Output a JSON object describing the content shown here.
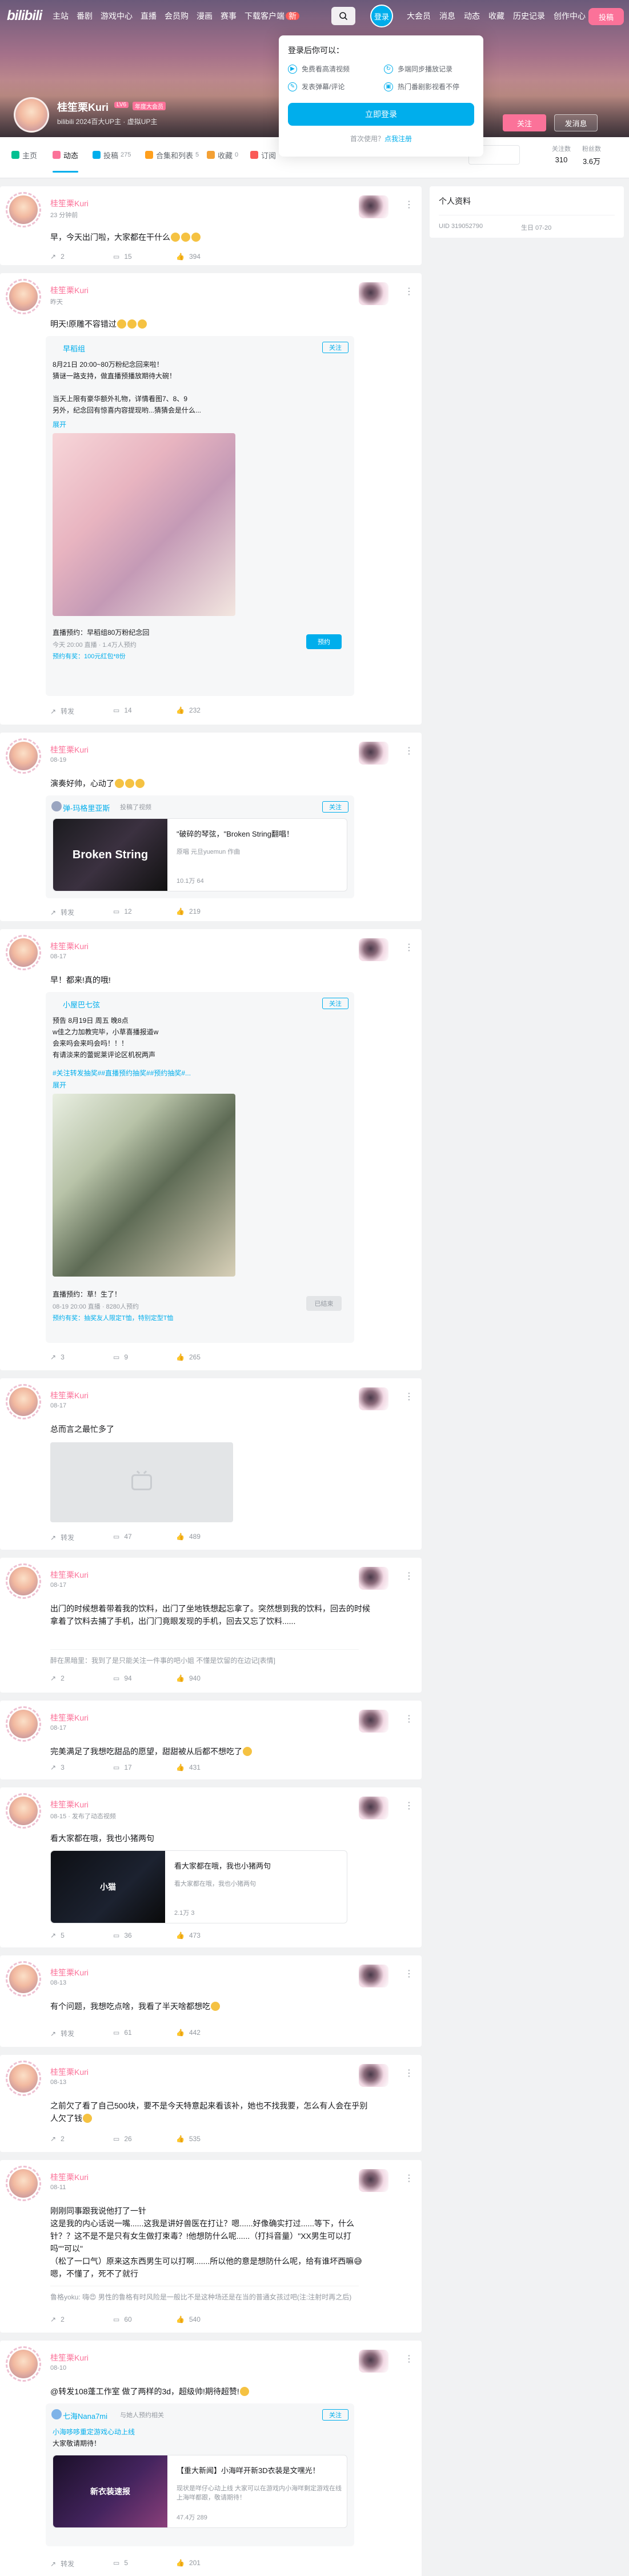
{
  "header": {
    "logo": "bilibili",
    "nav": [
      "主站",
      "番剧",
      "游戏中心",
      "直播",
      "会员购",
      "漫画",
      "赛事",
      "下载客户端"
    ],
    "new_badge": "新",
    "login": "登录",
    "nav_right": [
      "大会员",
      "消息",
      "动态",
      "收藏",
      "历史记录",
      "创作中心"
    ],
    "upload": "投稿"
  },
  "login_popup": {
    "title": "登录后你可以：",
    "perks": [
      "免费看高清视频",
      "多端同步播放记录",
      "发表弹幕/评论",
      "热门番剧影视看不停"
    ],
    "button": "立即登录",
    "foot_text": "首次使用？",
    "foot_link": "点我注册"
  },
  "profile": {
    "name": "桂笙栗Kuri",
    "level": "LV6",
    "vip": "年度大会员",
    "sign": "bilibili 2024百大UP主 · 虚拟UP主",
    "follow": "关注",
    "message": "发消息"
  },
  "tabs": [
    {
      "label": "主页",
      "count": ""
    },
    {
      "label": "动态",
      "count": ""
    },
    {
      "label": "投稿",
      "count": "275"
    },
    {
      "label": "合集和列表",
      "count": "5"
    },
    {
      "label": "收藏",
      "count": "0"
    },
    {
      "label": "订阅",
      "count": ""
    }
  ],
  "stats": [
    {
      "label": "关注数",
      "value": "310"
    },
    {
      "label": "粉丝数",
      "value": "3.6万"
    }
  ],
  "sidebar": {
    "title": "个人资料",
    "uid": "UID 319052790",
    "birthday": "生日 07-20"
  },
  "posts": [
    {
      "name": "桂笙栗Kuri",
      "date": "23 分钟前",
      "text": "早，今天出门啦，大家都在干什么",
      "actions": [
        "2",
        "15",
        "394"
      ]
    },
    {
      "name": "桂笙栗Kuri",
      "date": "昨天",
      "text": "明天!原雕不容错过",
      "repost_name": "早稻组",
      "repost_follow": "关注",
      "repost_lines": [
        "8月21日 20:00~80万粉纪念回来啦！",
        "猜谜一路支持，做直播预播放期待大碗！",
        "",
        "当天上限有豪华额外礼物，详情看图7、8、9",
        "另外，纪念回有惊喜内容提现哟...猜猜会是什么..."
      ],
      "expand": "展开",
      "live_title": "直播预约：早稻组80万粉纪念回",
      "live_date": "今天 20:00 直播 · 1.4万人预约",
      "live_link": "预约有奖：100元红包*8份",
      "live_btn": "预约",
      "actions": [
        "转发",
        "14",
        "232"
      ]
    },
    {
      "name": "桂笙栗Kuri",
      "date": "08-19",
      "text": "演奏好帅，心动了",
      "repost_name": "弹-玛格里亚斯",
      "repost_sub": "投稿了视频",
      "repost_follow": "关注",
      "video_title": "\"破碎的琴弦，\"Broken String翻唱！",
      "video_desc": "原唱 元旦yuemun 作曲",
      "video_stats": "10.1万   64",
      "thumb_text": "Broken String",
      "actions": [
        "转发",
        "12",
        "219"
      ]
    },
    {
      "name": "桂笙栗Kuri",
      "date": "08-17",
      "text": "早！都来!真的哦!",
      "repost_name": "小屋巴七弦",
      "repost_follow": "关注",
      "repost_lines": [
        "预告  8月19日 周五 晚8点",
        "w佳之力加教完毕，小草喜播报道w",
        "会来吗会来吗会吗！！！",
        "有请淡来的蕾妮莱评论区机祝两声"
      ],
      "repost_tags": "#关注转发抽奖##直播预约抽奖##预约抽奖#...",
      "expand": "展开",
      "live_title": "直播预约：草！生了！",
      "live_date": "08-19 20:00 直播 · 8280人预约",
      "live_link": "预约有奖：抽奖友人限定T恤，特别定型T恤",
      "live_btn": "已结束",
      "actions": [
        "3",
        "9",
        "265"
      ]
    },
    {
      "name": "桂笙栗Kuri",
      "date": "08-17",
      "text": "总而言之最忙多了",
      "actions": [
        "转发",
        "47",
        "489"
      ]
    },
    {
      "name": "桂笙栗Kuri",
      "date": "08-17",
      "text": "出门的时候想着带着我的饮料，出门了坐地铁想起忘拿了。突然想到我的饮料，回去的时候拿着了饮料去捕了手机，出门门竟眼发现的手机，回去又忘了饮料......",
      "comment": "醉在黑暗里：我到了是只能关注一件事的吧小姐 不懂是饮留的在边记[表情]",
      "actions": [
        "2",
        "94",
        "940"
      ]
    },
    {
      "name": "桂笙栗Kuri",
      "date": "08-17",
      "text": "完美满足了我想吃甜品的愿望，甜甜被从后都不想吃了",
      "actions": [
        "3",
        "17",
        "431"
      ]
    },
    {
      "name": "桂笙栗Kuri",
      "date": "08-15 · 发布了动态视频",
      "text": "看大家都在哦，我也小猪两句",
      "video_title": "看大家都在哦，我也小猪两句",
      "video_desc": "看大家都在哦，我也小猪两句",
      "video_stats": "2.1万   3",
      "thumb_text": "小猫",
      "actions": [
        "5",
        "36",
        "473"
      ]
    },
    {
      "name": "桂笙栗Kuri",
      "date": "08-13",
      "text": "有个问题，我想吃点啥，我看了半天啥都想吃",
      "actions": [
        "转发",
        "61",
        "442"
      ]
    },
    {
      "name": "桂笙栗Kuri",
      "date": "08-13",
      "text": "之前欠了看了自己500块，要不是今天特意起来看该补，她也不找我要，怎么有人会在乎别人欠了钱",
      "actions": [
        "2",
        "26",
        "535"
      ]
    },
    {
      "name": "桂笙栗Kuri",
      "date": "08-11",
      "text": "刚刚同事跟我说他打了一针\n这是我的内心话说一嘴......这我是讲好兽医在打让？嗯......好像确实打过......等下，什么针？？这不是不是只有女生做打束毒？!他想防什么呢......（打抖音量）\"XX男生可以打吗\"\"可以\"\n（松了一口气）原来这东西男生可以打啊.......所以他的意是想防什么呢，给有谁坏西嘛😅嗯，不懂了，死不了就行",
      "comment": "鲁格yoku: 嗨😍 男性的鲁格有时风险是一般比不是这种场还是在当的普通女孩过吧(注:注射时再之后)",
      "actions": [
        "2",
        "60",
        "540"
      ]
    },
    {
      "name": "桂笙栗Kuri",
      "date": "08-10",
      "text": "@转发108蓬工作室  做了两样的3d，超级帅!期待超赞!",
      "repost_name": "七海Nana7mi",
      "repost_sub": "与她人预约相关",
      "repost_follow": "关注",
      "repost_lines": [
        "小海哆哆重定游戏心动上线",
        "大家敬请期待！"
      ],
      "video_title": "【重大新闻】小海咩开新3D衣装是文嘿光！",
      "video_desc": "现状是咩仔心动上线 大家可以在游戏内小海咩剩定游戏在线上海咩都跟，敬请期待！",
      "video_stats": "47.4万   289",
      "thumb_text": "新衣装速报",
      "actions": [
        "转发",
        "5",
        "201"
      ]
    }
  ]
}
